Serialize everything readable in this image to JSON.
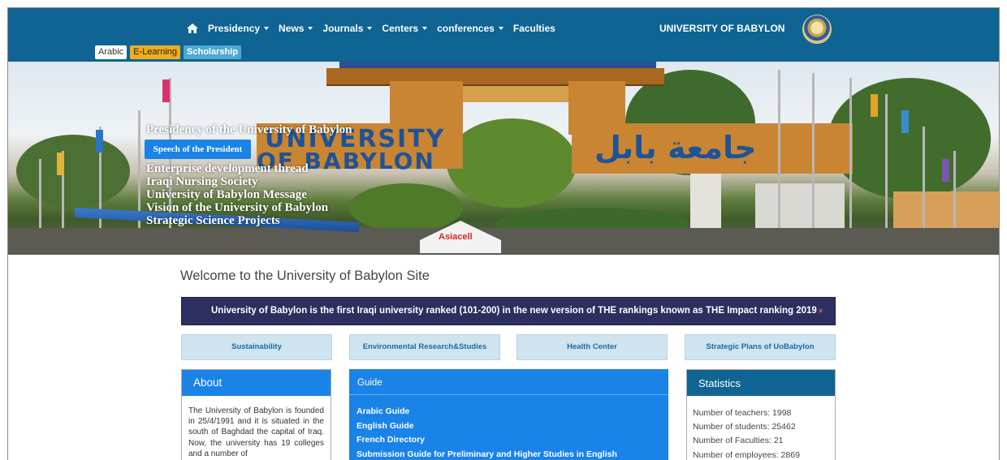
{
  "nav": {
    "home_icon": "home-icon",
    "items": [
      {
        "label": "Presidency",
        "dropdown": true
      },
      {
        "label": "News",
        "dropdown": true
      },
      {
        "label": "Journals",
        "dropdown": true
      },
      {
        "label": "Centers",
        "dropdown": true
      },
      {
        "label": "conferences",
        "dropdown": true
      },
      {
        "label": "Faculties",
        "dropdown": false
      }
    ],
    "university_title": "UNIVERSITY OF BABYLON",
    "quick_links": {
      "arabic": "Arabic",
      "elearning": "E-Learning",
      "scholarship": "Scholarship"
    }
  },
  "hero": {
    "sign_en_line1": "UNIVERSITY",
    "sign_en_line2": "OF BABYLON",
    "sign_ar": "جامعة بابل",
    "tent_label": "Asiacell",
    "speech_button": "Speech of the President",
    "slide_links": [
      "Presidency of the University of Babylon",
      "Enterprise development thread",
      "Iraqi Nursing Society",
      "University of Babylon Message",
      "Vision of the University of Babylon",
      "Strategic Science Projects"
    ]
  },
  "main": {
    "welcome": "Welcome to the University of Babylon Site",
    "announcement": "University of Babylon is the first Iraqi university ranked (101-200) in the new version of THE rankings known as THE Impact ranking 2019",
    "announcement_close": "×",
    "tiles": [
      "Sustainability",
      "Environmental Research&Studies",
      "Health Center",
      "Strategic Plans of UoBabylon"
    ],
    "about": {
      "title": "About",
      "text": "The University of Babylon is founded in 25/4/1991 and it is situated in the south of Baghdad the capital of Iraq. Now, the university has 19 colleges and a number of"
    },
    "guide": {
      "title": "Guide",
      "items": [
        "Arabic Guide",
        "English Guide",
        "French Directory",
        "Submission Guide for Preliminary and Higher Studies in English"
      ]
    },
    "stats": {
      "title": "Statistics",
      "items": [
        "Number of teachers: 1998",
        "Number of students: 25462",
        "Number of Faculties: 21",
        "Number of employees: 2869"
      ]
    }
  },
  "colors": {
    "topbar": "#0f6493",
    "accent": "#1a83e8",
    "announcement_bg": "#2d2f5e",
    "tile_bg": "#cfe4ee"
  }
}
